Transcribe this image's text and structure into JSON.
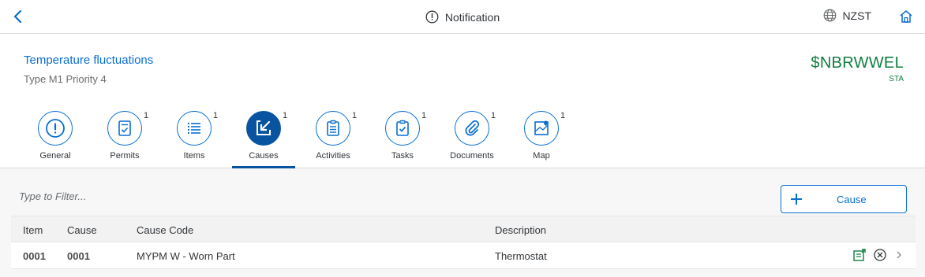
{
  "shell": {
    "title": "Notification",
    "timezone": "NZST"
  },
  "header": {
    "title": "Temperature fluctuations",
    "subtitle": "Type M1 Priority 4",
    "status": "$NBRWWEL",
    "status_label": "STA"
  },
  "tabs": [
    {
      "label": "General",
      "count": "",
      "icon": "exclamation-icon"
    },
    {
      "label": "Permits",
      "count": "1",
      "icon": "permit-document-icon"
    },
    {
      "label": "Items",
      "count": "1",
      "icon": "list-icon"
    },
    {
      "label": "Causes",
      "count": "1",
      "icon": "cause-arrow-icon",
      "active": true
    },
    {
      "label": "Activities",
      "count": "1",
      "icon": "clipboard-list-icon"
    },
    {
      "label": "Tasks",
      "count": "1",
      "icon": "clipboard-check-icon"
    },
    {
      "label": "Documents",
      "count": "1",
      "icon": "paperclip-icon"
    },
    {
      "label": "Map",
      "count": "1",
      "icon": "map-icon"
    }
  ],
  "filter": {
    "placeholder": "Type to Filter..."
  },
  "add_button": {
    "label": "Cause"
  },
  "table": {
    "columns": [
      "Item",
      "Cause",
      "Cause Code",
      "Description"
    ],
    "rows": [
      {
        "item": "0001",
        "cause": "0001",
        "cause_code": "MYPM W - Worn Part",
        "description": "Thermostat"
      }
    ]
  },
  "colors": {
    "accent": "#0a6ed1",
    "active_tab": "#0854a0",
    "status": "#107e3e"
  }
}
